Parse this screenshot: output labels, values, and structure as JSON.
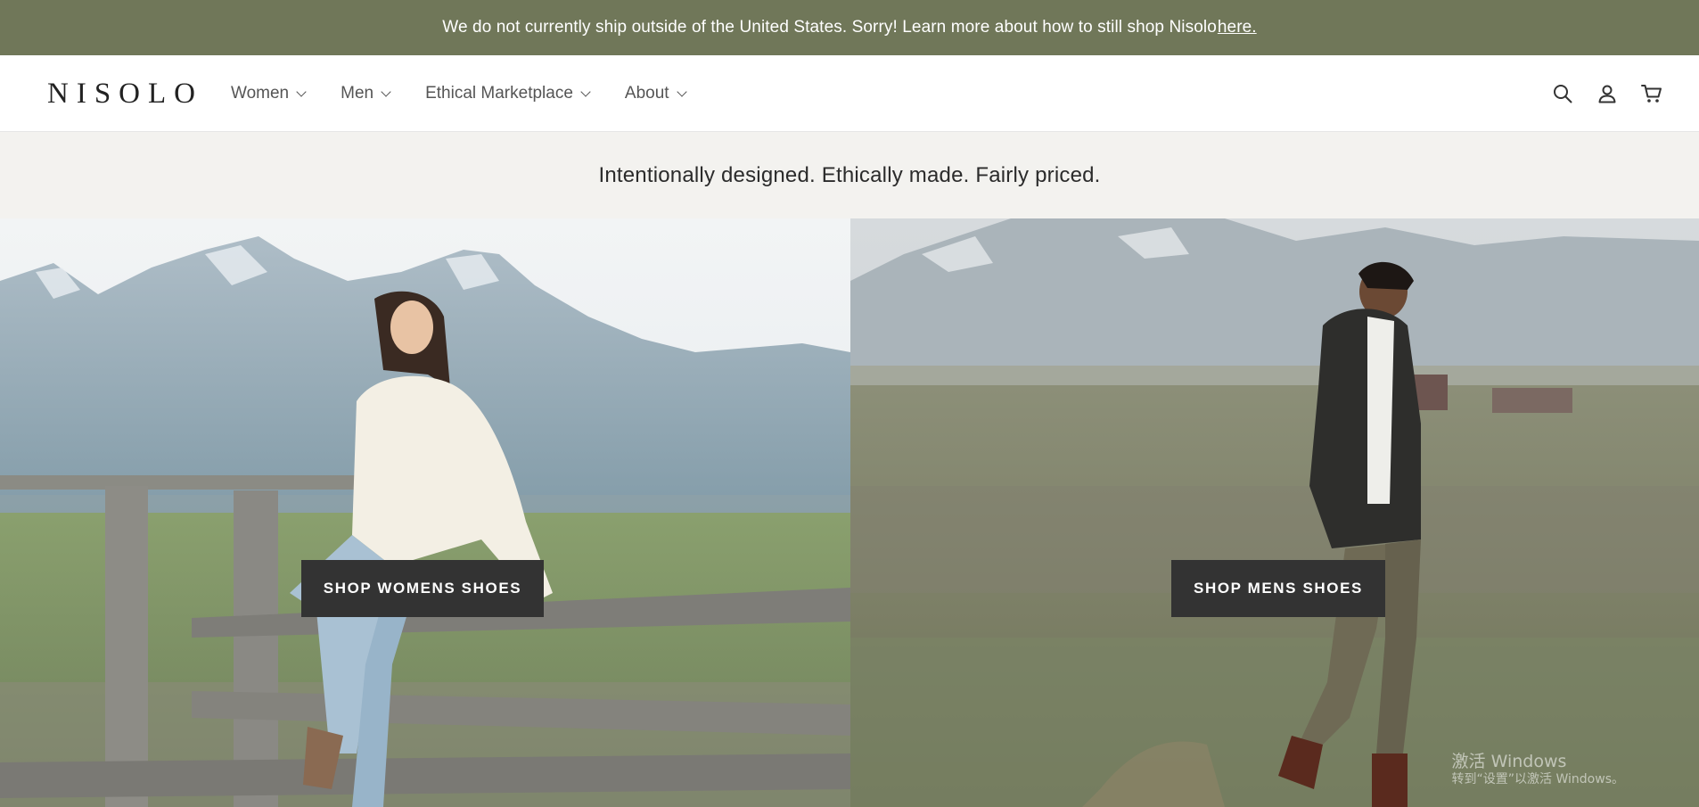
{
  "announcement": {
    "text": "We do not currently ship outside of the United States. Sorry! Learn more about how to still shop Nisolo ",
    "link_label": "here."
  },
  "header": {
    "logo": "NISOLO",
    "nav": [
      {
        "label": "Women"
      },
      {
        "label": "Men"
      },
      {
        "label": "Ethical Marketplace"
      },
      {
        "label": "About"
      }
    ],
    "icons": [
      "search-icon",
      "account-icon",
      "cart-icon"
    ]
  },
  "tagline": "Intentionally designed. Ethically made. Fairly priced.",
  "hero": {
    "womens_button": "SHOP WOMENS SHOES",
    "mens_button": "SHOP MENS SHOES"
  },
  "watermark": {
    "line1": "激活 Windows",
    "line2": "转到“设置”以激活 Windows。"
  },
  "colors": {
    "announcement_bg": "#707759",
    "tagline_bg": "#f3f2ef",
    "button_bg": "#333333"
  }
}
